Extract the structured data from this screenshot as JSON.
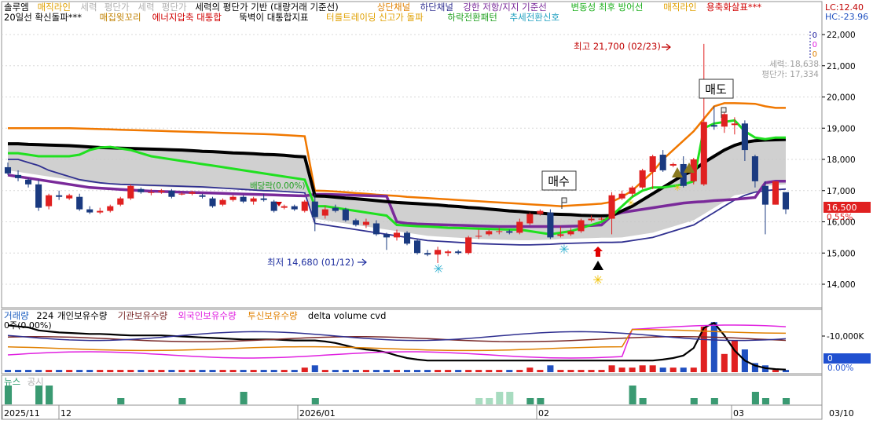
{
  "legend_row1": [
    {
      "text": "솔루엠",
      "color": "#000000"
    },
    {
      "text": "매직라인",
      "color": "#e0a000"
    },
    {
      "text": "세력",
      "color": "#b0b0b0"
    },
    {
      "text": "평단가",
      "color": "#b0b0b0"
    },
    {
      "text": "세력",
      "color": "#b0b0b0"
    },
    {
      "text": "평단가",
      "color": "#b0b0b0"
    },
    {
      "text": "세력의 평단가 기반 (대량거래 기준선)",
      "color": "#000000"
    },
    {
      "text": "상단채널",
      "color": "#e08000"
    },
    {
      "text": "하단채널",
      "color": "#303090"
    },
    {
      "text": "강한 저항/지지 기준선",
      "color": "#7a2a9a"
    },
    {
      "text": "변동성 최후 방어선",
      "color": "#20b020"
    },
    {
      "text": "매직라인",
      "color": "#e0a000"
    },
    {
      "text": "용축화살표***",
      "color": "#d00000"
    }
  ],
  "legend_row2": [
    {
      "text": "20일선 확신돌파***",
      "color": "#000000"
    },
    {
      "text": "매집윗꼬리",
      "color": "#c08000"
    },
    {
      "text": "에너지압축 대통합",
      "color": "#d00000"
    },
    {
      "text": "뚝벽이 대통합지표",
      "color": "#000000"
    },
    {
      "text": "터를트레이딩 신고가 돌파",
      "color": "#e0a000"
    },
    {
      "text": "하락전환패턴",
      "color": "#20a020"
    },
    {
      "text": "추세전환신호",
      "color": "#20a0c0"
    }
  ],
  "header_right": {
    "lc": "LC:12.40",
    "hc": "HC:-23.96"
  },
  "overlay_zero": [
    "0",
    "0",
    "0"
  ],
  "info_text": {
    "power": "세력: 18,638",
    "avg": "평단가: 17,334"
  },
  "annotations": {
    "high": "최고 21,700 (02/23)",
    "low": "최저 14,680 (01/12)",
    "dividend": "배당락(0.00%)",
    "buy": "매수",
    "sell": "매도"
  },
  "price_tag": {
    "price": "16,500",
    "pct": "0.55%"
  },
  "volume_legend": [
    {
      "text": "거래량",
      "color": "#2060c0"
    },
    {
      "text": "224",
      "color": "#000000"
    },
    {
      "text": "개인보유수량",
      "color": "#000000"
    },
    {
      "text": "기관보유수량",
      "color": "#7a2a2a"
    },
    {
      "text": "외국인보유수량",
      "color": "#e020e0"
    },
    {
      "text": "투신보유수량",
      "color": "#e08000"
    },
    {
      "text": "delta volume cvd",
      "color": "#000000"
    }
  ],
  "volume_sub_label": "0주(0.00%)",
  "volume_axis": "-10,000K",
  "volume_tag": {
    "value": "0",
    "pct": "0.00%"
  },
  "news_legend": [
    {
      "text": "뉴스",
      "color": "#2a9a6a"
    },
    {
      "text": "공시",
      "color": "#b0b0b0"
    }
  ],
  "x_labels": [
    "2025/11",
    "12",
    "2026/01",
    "02",
    "03",
    "03/10"
  ],
  "chart_data": {
    "type": "candlestick",
    "y_ticks": [
      22000,
      21000,
      20000,
      19000,
      18000,
      17000,
      16000,
      15000,
      14000
    ],
    "ylim": [
      13400,
      22400
    ],
    "y_tick_labels": [
      "22,000",
      "21,000",
      "20,000",
      "19,000",
      "18,000",
      "17,000",
      "16,000",
      "15,000",
      "14,000"
    ],
    "candles": [
      [
        17750,
        17900,
        17500,
        17550
      ],
      [
        17500,
        17650,
        17300,
        17400
      ],
      [
        17350,
        17400,
        17100,
        17200
      ],
      [
        17200,
        17350,
        16350,
        16450
      ],
      [
        16500,
        16900,
        16400,
        16850
      ],
      [
        16850,
        17000,
        16700,
        16800
      ],
      [
        16750,
        16900,
        16700,
        16850
      ],
      [
        16800,
        16900,
        16350,
        16400
      ],
      [
        16400,
        16500,
        16250,
        16300
      ],
      [
        16300,
        16450,
        16250,
        16350
      ],
      [
        16350,
        16550,
        16300,
        16500
      ],
      [
        16550,
        16800,
        16500,
        16750
      ],
      [
        16750,
        17200,
        16700,
        17150
      ],
      [
        17050,
        17100,
        16900,
        16950
      ],
      [
        16950,
        17050,
        16850,
        16950
      ],
      [
        16950,
        17050,
        16900,
        17000
      ],
      [
        17000,
        17050,
        16750,
        16800
      ],
      [
        16900,
        16950,
        16850,
        16900
      ],
      [
        16900,
        17000,
        16850,
        16950
      ],
      [
        16850,
        16900,
        16750,
        16800
      ],
      [
        16750,
        16800,
        16450,
        16500
      ],
      [
        16550,
        16750,
        16500,
        16700
      ],
      [
        16700,
        16850,
        16650,
        16800
      ],
      [
        16800,
        16850,
        16600,
        16650
      ],
      [
        16650,
        16800,
        16550,
        16750
      ],
      [
        16750,
        16900,
        16650,
        16700
      ],
      [
        16650,
        16700,
        16300,
        16350
      ],
      [
        16450,
        16550,
        16400,
        16500
      ],
      [
        16500,
        16550,
        16350,
        16400
      ],
      [
        16350,
        16700,
        16300,
        16650
      ],
      [
        16650,
        16900,
        15700,
        16150
      ],
      [
        16200,
        16500,
        16100,
        16400
      ],
      [
        16450,
        16550,
        16300,
        16350
      ],
      [
        16400,
        16450,
        16000,
        16050
      ],
      [
        16050,
        16100,
        15850,
        15900
      ],
      [
        15900,
        16100,
        15800,
        16000
      ],
      [
        15950,
        16050,
        15550,
        15600
      ],
      [
        15600,
        15650,
        15100,
        15500
      ],
      [
        15500,
        15750,
        15400,
        15650
      ],
      [
        15650,
        15700,
        15250,
        15300
      ],
      [
        15400,
        15450,
        14950,
        15000
      ],
      [
        15000,
        15100,
        14900,
        14950
      ],
      [
        14950,
        15200,
        14680,
        15100
      ],
      [
        15000,
        15100,
        14900,
        15050
      ],
      [
        15050,
        15100,
        14950,
        15000
      ],
      [
        15000,
        15550,
        14950,
        15500
      ],
      [
        15550,
        15750,
        15450,
        15550
      ],
      [
        15600,
        15750,
        15550,
        15700
      ],
      [
        15700,
        15800,
        15600,
        15700
      ],
      [
        15700,
        15750,
        15600,
        15650
      ],
      [
        15650,
        16100,
        15600,
        16000
      ],
      [
        15950,
        16300,
        15900,
        16250
      ],
      [
        16250,
        16400,
        16200,
        16350
      ],
      [
        16300,
        16400,
        15450,
        15500
      ],
      [
        15550,
        15850,
        15500,
        15600
      ],
      [
        15600,
        15800,
        15550,
        15700
      ],
      [
        15700,
        16100,
        15650,
        16050
      ],
      [
        16050,
        16200,
        16000,
        16100
      ],
      [
        16100,
        16150,
        16050,
        16100
      ],
      [
        16100,
        16950,
        15600,
        16850
      ],
      [
        16750,
        17000,
        16700,
        16900
      ],
      [
        16900,
        17150,
        16800,
        17100
      ],
      [
        17100,
        17700,
        17050,
        17650
      ],
      [
        17600,
        18150,
        17050,
        18100
      ],
      [
        18150,
        18300,
        17600,
        17650
      ],
      [
        17800,
        17900,
        17750,
        17850
      ],
      [
        17850,
        18100,
        17100,
        17150
      ],
      [
        17300,
        18050,
        17200,
        18000
      ],
      [
        17200,
        21700,
        17150,
        19200
      ],
      [
        19100,
        19700,
        18950,
        19050
      ],
      [
        19050,
        19550,
        18850,
        19450
      ],
      [
        19100,
        19350,
        18800,
        19150
      ],
      [
        19150,
        19250,
        17950,
        18300
      ],
      [
        18100,
        18150,
        17100,
        17300
      ],
      [
        17150,
        17300,
        15600,
        16550
      ],
      [
        16550,
        17300,
        16550,
        17300
      ],
      [
        16950,
        16950,
        16250,
        16400
      ]
    ],
    "ma20": [
      18500,
      18500,
      18480,
      18470,
      18460,
      18450,
      18440,
      18420,
      18400,
      18380,
      18370,
      18360,
      18350,
      18340,
      18330,
      18320,
      18310,
      18300,
      18280,
      18260,
      18250,
      18230,
      18210,
      18200,
      18180,
      18160,
      18150,
      18130,
      18100,
      18080,
      16830,
      16820,
      16790,
      16760,
      16740,
      16710,
      16680,
      16650,
      16620,
      16600,
      16580,
      16560,
      16540,
      16510,
      16490,
      16460,
      16440,
      16410,
      16380,
      16350,
      16330,
      16300,
      16280,
      16250,
      16240,
      16230,
      16210,
      16200,
      16190,
      16200,
      16350,
      16500,
      16700,
      16900,
      17100,
      17300,
      17500,
      17650,
      17900,
      18100,
      18300,
      18450,
      18550,
      18600,
      18620,
      18630,
      18640
    ],
    "upper": [
      19000,
      19000,
      19000,
      19000,
      19000,
      19000,
      19000,
      18990,
      18980,
      18970,
      18960,
      18950,
      18940,
      18930,
      18920,
      18910,
      18900,
      18890,
      18880,
      18870,
      18860,
      18850,
      18840,
      18830,
      18820,
      18810,
      18800,
      18780,
      18760,
      18740,
      17000,
      16990,
      16970,
      16950,
      16920,
      16900,
      16870,
      16850,
      16830,
      16800,
      16780,
      16760,
      16740,
      16720,
      16700,
      16680,
      16660,
      16640,
      16620,
      16600,
      16580,
      16560,
      16540,
      16520,
      16500,
      16520,
      16540,
      16560,
      16580,
      16640,
      16800,
      17000,
      17300,
      17600,
      18000,
      18300,
      18600,
      18900,
      19300,
      19700,
      19800,
      19800,
      19790,
      19780,
      19700,
      19650,
      19650
    ],
    "lower": [
      18000,
      18000,
      17900,
      17800,
      17650,
      17550,
      17450,
      17350,
      17300,
      17250,
      17220,
      17200,
      17190,
      17180,
      17170,
      17160,
      17150,
      17140,
      17130,
      17120,
      17100,
      17080,
      17060,
      17040,
      17020,
      17000,
      16990,
      16970,
      16950,
      16930,
      15950,
      15900,
      15850,
      15800,
      15750,
      15700,
      15650,
      15600,
      15550,
      15500,
      15450,
      15400,
      15380,
      15360,
      15340,
      15320,
      15300,
      15290,
      15280,
      15270,
      15260,
      15260,
      15270,
      15280,
      15300,
      15310,
      15320,
      15330,
      15340,
      15340,
      15350,
      15400,
      15450,
      15500,
      15600,
      15700,
      15800,
      15900,
      16100,
      16300,
      16500,
      16700,
      16850,
      16950,
      17000,
      17030,
      17050
    ],
    "support": [
      17500,
      17450,
      17400,
      17350,
      17300,
      17250,
      17200,
      17150,
      17100,
      17080,
      17060,
      17040,
      17020,
      17000,
      16980,
      16970,
      16960,
      16950,
      16940,
      16930,
      16920,
      16910,
      16900,
      16890,
      16880,
      16870,
      16860,
      16850,
      16840,
      16830,
      16880,
      16880,
      16870,
      16860,
      16850,
      16840,
      16830,
      16820,
      16000,
      15950,
      15930,
      15920,
      15910,
      15900,
      15890,
      15880,
      15870,
      15860,
      15850,
      15850,
      15850,
      15850,
      15850,
      15850,
      15850,
      15860,
      15870,
      15880,
      15900,
      16200,
      16300,
      16350,
      16400,
      16450,
      16500,
      16550,
      16600,
      16630,
      16650,
      16680,
      16700,
      16720,
      16750,
      16780,
      17250,
      17300,
      17300
    ],
    "defense": [
      18200,
      18200,
      18150,
      18100,
      18100,
      18100,
      18100,
      18150,
      18300,
      18380,
      18400,
      18350,
      18300,
      18200,
      18100,
      18050,
      18000,
      17950,
      17900,
      17850,
      17800,
      17750,
      17700,
      17650,
      17600,
      17550,
      17500,
      17450,
      17400,
      17350,
      16500,
      16500,
      16450,
      16400,
      16350,
      16300,
      16250,
      16200,
      15900,
      15880,
      15860,
      15850,
      15830,
      15810,
      15800,
      15790,
      15780,
      15770,
      15760,
      15750,
      15750,
      15700,
      15650,
      15600,
      15650,
      15700,
      15800,
      15900,
      16000,
      16200,
      16500,
      16800,
      17000,
      17100,
      17100,
      17150,
      17200,
      17300,
      19000,
      19150,
      19200,
      19250,
      18900,
      18700,
      18650,
      18700,
      18700
    ]
  },
  "volume_data": {
    "bars": [
      1,
      1,
      1,
      1,
      1,
      1,
      1,
      1,
      1,
      1,
      1,
      1,
      1,
      1,
      1,
      1,
      1,
      1,
      1,
      1,
      1,
      1,
      1,
      1,
      1,
      1,
      1,
      1,
      1,
      2,
      3,
      1,
      1,
      1,
      1,
      1,
      1,
      1,
      1,
      1,
      1,
      1,
      1,
      1,
      1,
      1,
      1,
      1,
      1,
      1,
      1,
      2,
      1,
      3,
      1,
      1,
      1,
      1,
      1,
      3,
      2,
      2,
      3,
      3,
      2,
      2,
      2,
      2,
      20,
      22,
      8,
      14,
      10,
      4,
      3,
      1,
      1
    ],
    "cvd": [
      0.9,
      0.88,
      0.86,
      0.8,
      0.78,
      0.76,
      0.75,
      0.74,
      0.73,
      0.73,
      0.72,
      0.71,
      0.7,
      0.7,
      0.7,
      0.7,
      0.69,
      0.68,
      0.67,
      0.66,
      0.65,
      0.64,
      0.63,
      0.62,
      0.62,
      0.62,
      0.62,
      0.61,
      0.6,
      0.6,
      0.6,
      0.58,
      0.55,
      0.5,
      0.45,
      0.42,
      0.4,
      0.36,
      0.3,
      0.25,
      0.22,
      0.2,
      0.2,
      0.2,
      0.2,
      0.2,
      0.2,
      0.2,
      0.2,
      0.2,
      0.2,
      0.2,
      0.2,
      0.2,
      0.2,
      0.2,
      0.2,
      0.2,
      0.2,
      0.2,
      0.2,
      0.2,
      0.2,
      0.2,
      0.22,
      0.25,
      0.3,
      0.45,
      0.85,
      0.95,
      0.7,
      0.4,
      0.2,
      0.1,
      0.05,
      0.03,
      0.02
    ]
  },
  "news_data": [
    3,
    0,
    0,
    3,
    3,
    0,
    0,
    0,
    0,
    0,
    0,
    1,
    0,
    0,
    0,
    0,
    0,
    1,
    0,
    0,
    0,
    0,
    0,
    2,
    0,
    0,
    0,
    0,
    0,
    0,
    1,
    0,
    0,
    0,
    0,
    0,
    0,
    0,
    0,
    0,
    0,
    0,
    0,
    0,
    0,
    0,
    1,
    1,
    2,
    2,
    0,
    1,
    1,
    0,
    0,
    0,
    0,
    0,
    0,
    0,
    0,
    3,
    1,
    0,
    0,
    0,
    0,
    1,
    0,
    1,
    0,
    0,
    0,
    2,
    1,
    0,
    1
  ]
}
